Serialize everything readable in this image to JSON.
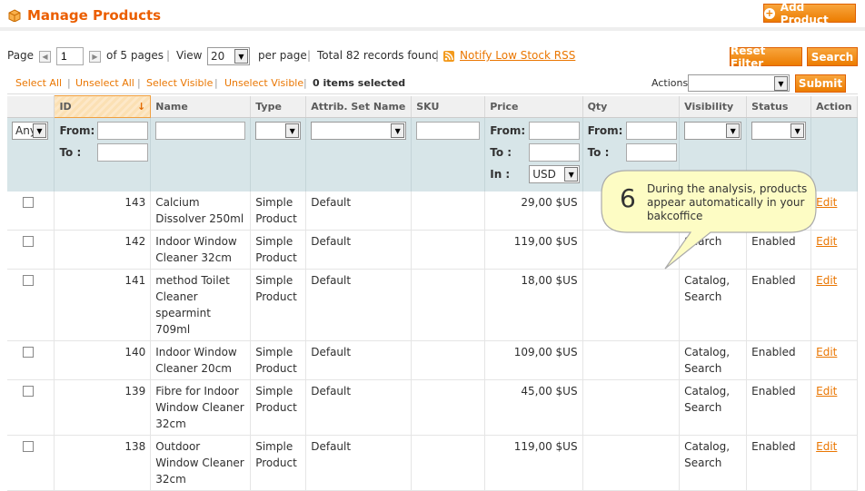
{
  "header": {
    "title": "Manage Products",
    "add_button": "Add Product"
  },
  "pager": {
    "page_label": "Page",
    "page_value": "1",
    "of_pages": "of 5 pages",
    "view_label": "View",
    "per_page_value": "20",
    "per_page_label": "per page",
    "total": "Total 82 records found",
    "rss_link": "Notify Low Stock RSS",
    "reset_button": "Reset Filter",
    "search_button": "Search"
  },
  "mass": {
    "select_all": "Select All",
    "unselect_all": "Unselect All",
    "select_visible": "Select Visible",
    "unselect_visible": "Unselect Visible",
    "selected": "0 items selected",
    "actions_label": "Actions",
    "submit": "Submit"
  },
  "columns": {
    "id": "ID",
    "name": "Name",
    "type": "Type",
    "attrib": "Attrib. Set Name",
    "sku": "SKU",
    "price": "Price",
    "qty": "Qty",
    "visibility": "Visibility",
    "status": "Status",
    "action": "Action"
  },
  "filters": {
    "any": "Any",
    "from": "From:",
    "to": "To :",
    "in": "In :",
    "currency": "USD"
  },
  "rows": [
    {
      "id": "143",
      "name": "Calcium Dissolver 250ml",
      "type": "Simple Product",
      "attrib": "Default",
      "price": "29,00 $US",
      "visibility": "",
      "status": "",
      "action": "Edit"
    },
    {
      "id": "142",
      "name": "Indoor Window Cleaner 32cm",
      "type": "Simple Product",
      "attrib": "Default",
      "price": "119,00 $US",
      "visibility": "Search",
      "status": "Enabled",
      "action": "Edit"
    },
    {
      "id": "141",
      "name": "method Toilet Cleaner spearmint 709ml",
      "type": "Simple Product",
      "attrib": "Default",
      "price": "18,00 $US",
      "visibility": "Catalog, Search",
      "status": "Enabled",
      "action": "Edit"
    },
    {
      "id": "140",
      "name": "Indoor Window Cleaner 20cm",
      "type": "Simple Product",
      "attrib": "Default",
      "price": "109,00 $US",
      "visibility": "Catalog, Search",
      "status": "Enabled",
      "action": "Edit"
    },
    {
      "id": "139",
      "name": "Fibre for Indoor Window Cleaner 32cm",
      "type": "Simple Product",
      "attrib": "Default",
      "price": "45,00 $US",
      "visibility": "Catalog, Search",
      "status": "Enabled",
      "action": "Edit"
    },
    {
      "id": "138",
      "name": "Outdoor Window Cleaner 32cm",
      "type": "Simple Product",
      "attrib": "Default",
      "price": "119,00 $US",
      "visibility": "Catalog, Search",
      "status": "Enabled",
      "action": "Edit"
    }
  ],
  "callout": {
    "number": "6",
    "text": "During the analysis, products appear automatically in your bakcoffice"
  }
}
